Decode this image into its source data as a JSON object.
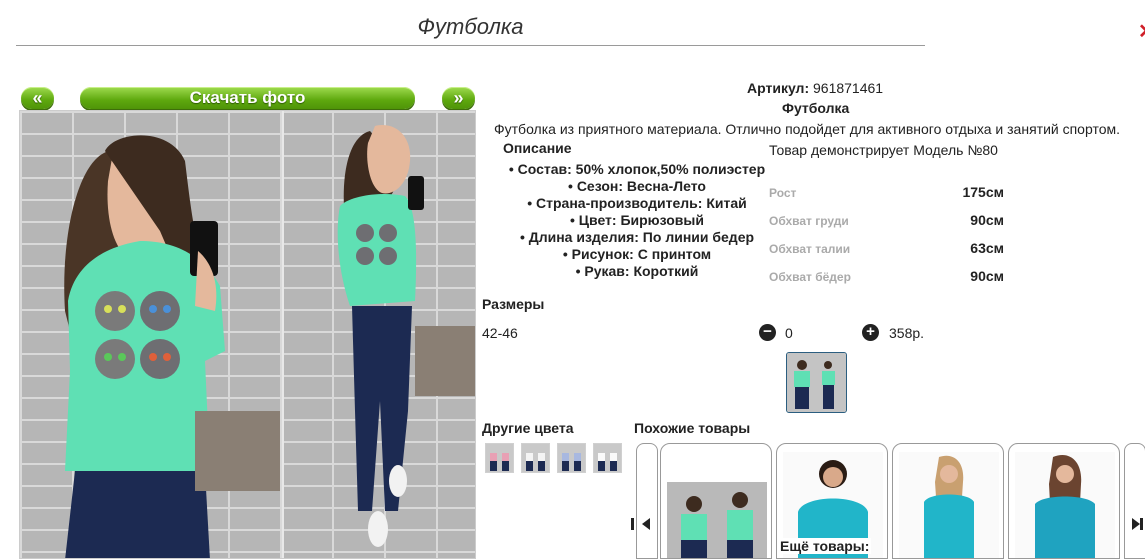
{
  "page_title": "Футболка",
  "gallery": {
    "prev_label": "«",
    "download_label": "Скачать фото",
    "next_label": "»"
  },
  "product": {
    "article_label": "Артикул:",
    "article_value": "961871461",
    "name": "Футболка",
    "description": "Футболка из приятного материала. Отлично подойдет для активного отдыха и занятий спортом.",
    "description_heading": "Описание",
    "features": [
      "• Состав: 50% хлопок,50% полиэстер",
      "• Сезон: Весна-Лето",
      "• Страна-производитель: Китай",
      "• Цвет: Бирюзовый",
      "• Длина изделия: По линии бедер",
      "• Рисунок: С принтом",
      "• Рукав: Короткий"
    ]
  },
  "model": {
    "caption": "Товар демонстрирует Модель №80",
    "measures": [
      {
        "label": "Рост",
        "value": "175см"
      },
      {
        "label": "Обхват груди",
        "value": "90см"
      },
      {
        "label": "Обхват талии",
        "value": "63см"
      },
      {
        "label": "Обхват бёдер",
        "value": "90см"
      }
    ]
  },
  "sizes": {
    "heading": "Размеры",
    "size": "42-46",
    "minus_icon": "minus-circle-icon",
    "quantity": "0",
    "plus_icon": "plus-circle-icon",
    "price": "358р."
  },
  "other_colors": {
    "heading": "Другие цвета"
  },
  "similar": {
    "heading": "Похожие товары",
    "more_label": "Ещё товары:"
  },
  "colors": {
    "accent_green": "#5ea80e",
    "shirt_mint": "#5fe0b4",
    "shirt_cyan": "#21b5c9",
    "jeans": "#1c2a52"
  }
}
